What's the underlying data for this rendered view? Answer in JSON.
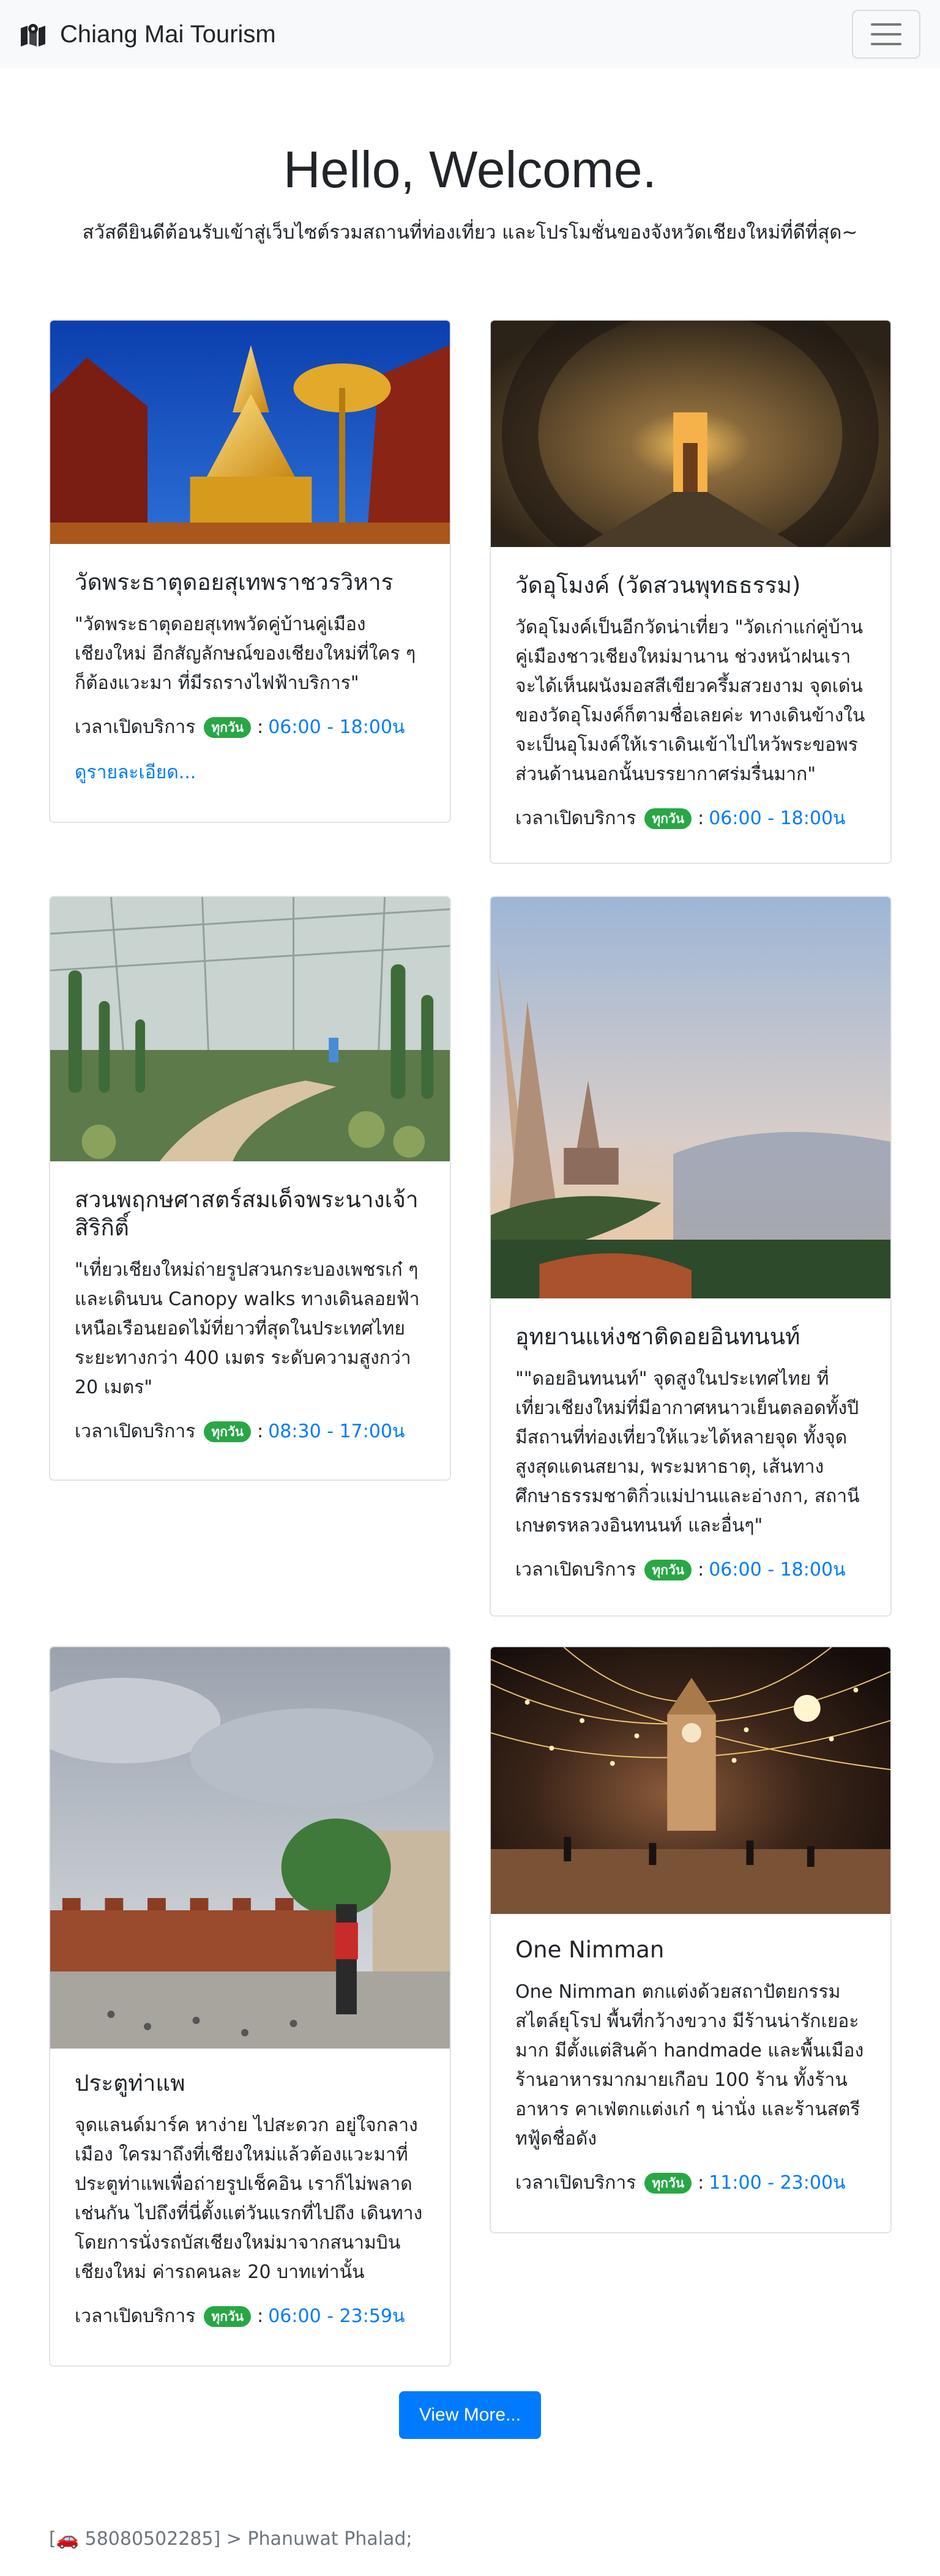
{
  "nav": {
    "brand": "Chiang Mai Tourism",
    "brand_icon": "map-icon",
    "menu_icon": "hamburger-menu-icon"
  },
  "hero": {
    "title": "Hello, Welcome.",
    "subtitle": "สวัสดียินดีต้อนรับเข้าสู่เว็บไซต์รวมสถานที่ท่องเที่ยว และโปรโมชั่นของจังหวัดเชียงใหม่ที่ดีที่สุด~"
  },
  "labels": {
    "hours_label": "เวลาเปิดบริการ",
    "everyday_badge": "ทุกวัน",
    "colon": ":"
  },
  "cards": [
    {
      "title": "วัดพระธาตุดอยสุเทพราชวรวิหาร",
      "text": "\"วัดพระธาตุดอยสุเทพวัดคู่บ้านคู่เมือง เชียงใหม่ อีกสัญลักษณ์ของเชียงใหม่ที่ใคร ๆ ก็ต้องแวะมา ที่มีรถรางไฟฟ้าบริการ\"",
      "time": "06:00 - 18:00น",
      "link": "ดูรายละเอียด...",
      "image": "golden pagoda with golden parasol against blue sky"
    },
    {
      "title": "วัดอุโมงค์ (วัดสวนพุทธธรรม)",
      "text": "วัดอุโมงค์เป็นอีกวัดน่าเที่ยว \"วัดเก่าแก่คู่บ้านคู่เมืองชาวเชียงใหม่มานาน ช่วงหน้าฝนเราจะได้เห็นผนังมอสสีเขียวครึ้มสวยงาม จุดเด่นของวัดอุโมงค์ก็ตามชื่อเลยค่ะ ทางเดินข้างในจะเป็นอุโมงค์ให้เราเดินเข้าไปไหว้พระขอพรส่วนด้านนอกนั้นบรรยากาศร่มรื่นมาก\"",
      "time": "06:00 - 18:00น",
      "image": "ancient brick tunnel corridor"
    },
    {
      "title": "สวนพฤกษศาสตร์สมเด็จพระนางเจ้าสิริกิติ์",
      "text": "\"เที่ยวเชียงใหม่ถ่ายรูปสวนกระบองเพชรเก๋ ๆ และเดินบน Canopy walks ทางเดินลอยฟ้าเหนือเรือนยอดไม้ที่ยาวที่สุดในประเทศไทย ระยะทางกว่า 400 เมตร ระดับความสูงกว่า 20 เมตร\"",
      "time": "08:30 - 17:00น",
      "image": "cactus greenhouse with walking path"
    },
    {
      "title": "อุทยานแห่งชาติดอยอินทนนท์",
      "text": "\"\"ดอยอินทนนท์\" จุดสูงในประเทศไทย ที่เที่ยวเชียงใหม่ที่มีอากาศหนาวเย็นตลอดทั้งปี มีสถานที่ท่องเที่ยวให้แวะได้หลายจุด ทั้งจุดสูงสุดแดนสยาม, พระมหาธาตุ, เส้นทางศึกษาธรรมชาติกิ่วแม่ปานและอ่างกา, สถานีเกษตรหลวงอินทนนท์ และอื่นๆ\"",
      "time": "06:00 - 18:00น",
      "image": "twin pagodas on mountain ridge at dusk"
    },
    {
      "title": "ประตูท่าแพ",
      "text": "จุดแลนด์มาร์ค หาง่าย ไปสะดวก อยู่ใจกลางเมือง ใครมาถึงที่เชียงใหม่แล้วต้องแวะมาที่ประตูท่าแพเพื่อถ่ายรูปเช็คอิน เราก็ไม่พลาดเช่นกัน ไปถึงที่นี่ตั้งแต่วันแรกที่ไปถึง เดินทางโดยการนั่งรถบัสเชียงใหม่มาจากสนามบินเชียงใหม่ ค่ารถคนละ 20 บาทเท่านั้น",
      "time": "06:00 - 23:59น",
      "image": "old city brick gate with pigeons and tourist"
    },
    {
      "title": "One Nimman",
      "text": "One Nimman ตกแต่งด้วยสถาปัตยกรรมสไตล์ยุโรป พื้นที่กว้างขวาง มีร้านน่ารักเยอะมาก มีตั้งแต่สินค้า handmade และพื้นเมือง ร้านอาหารมากมายเกือบ 100 ร้าน ทั้งร้านอาหาร คาเฟ่ตกแต่งเก๋ ๆ น่านั่ง และร้านสตรีทฟู้ดชื่อดัง",
      "time": "11:00 - 23:00น",
      "image": "night plaza with string lights and clock tower"
    }
  ],
  "view_more": "View More...",
  "footer": {
    "car_icon": "car-icon",
    "text": "58080502285] > Phanuwat Phalad;"
  },
  "colors": {
    "primary": "#007bff",
    "badge": "#28a745",
    "navbar_bg": "#f8f9fa"
  }
}
